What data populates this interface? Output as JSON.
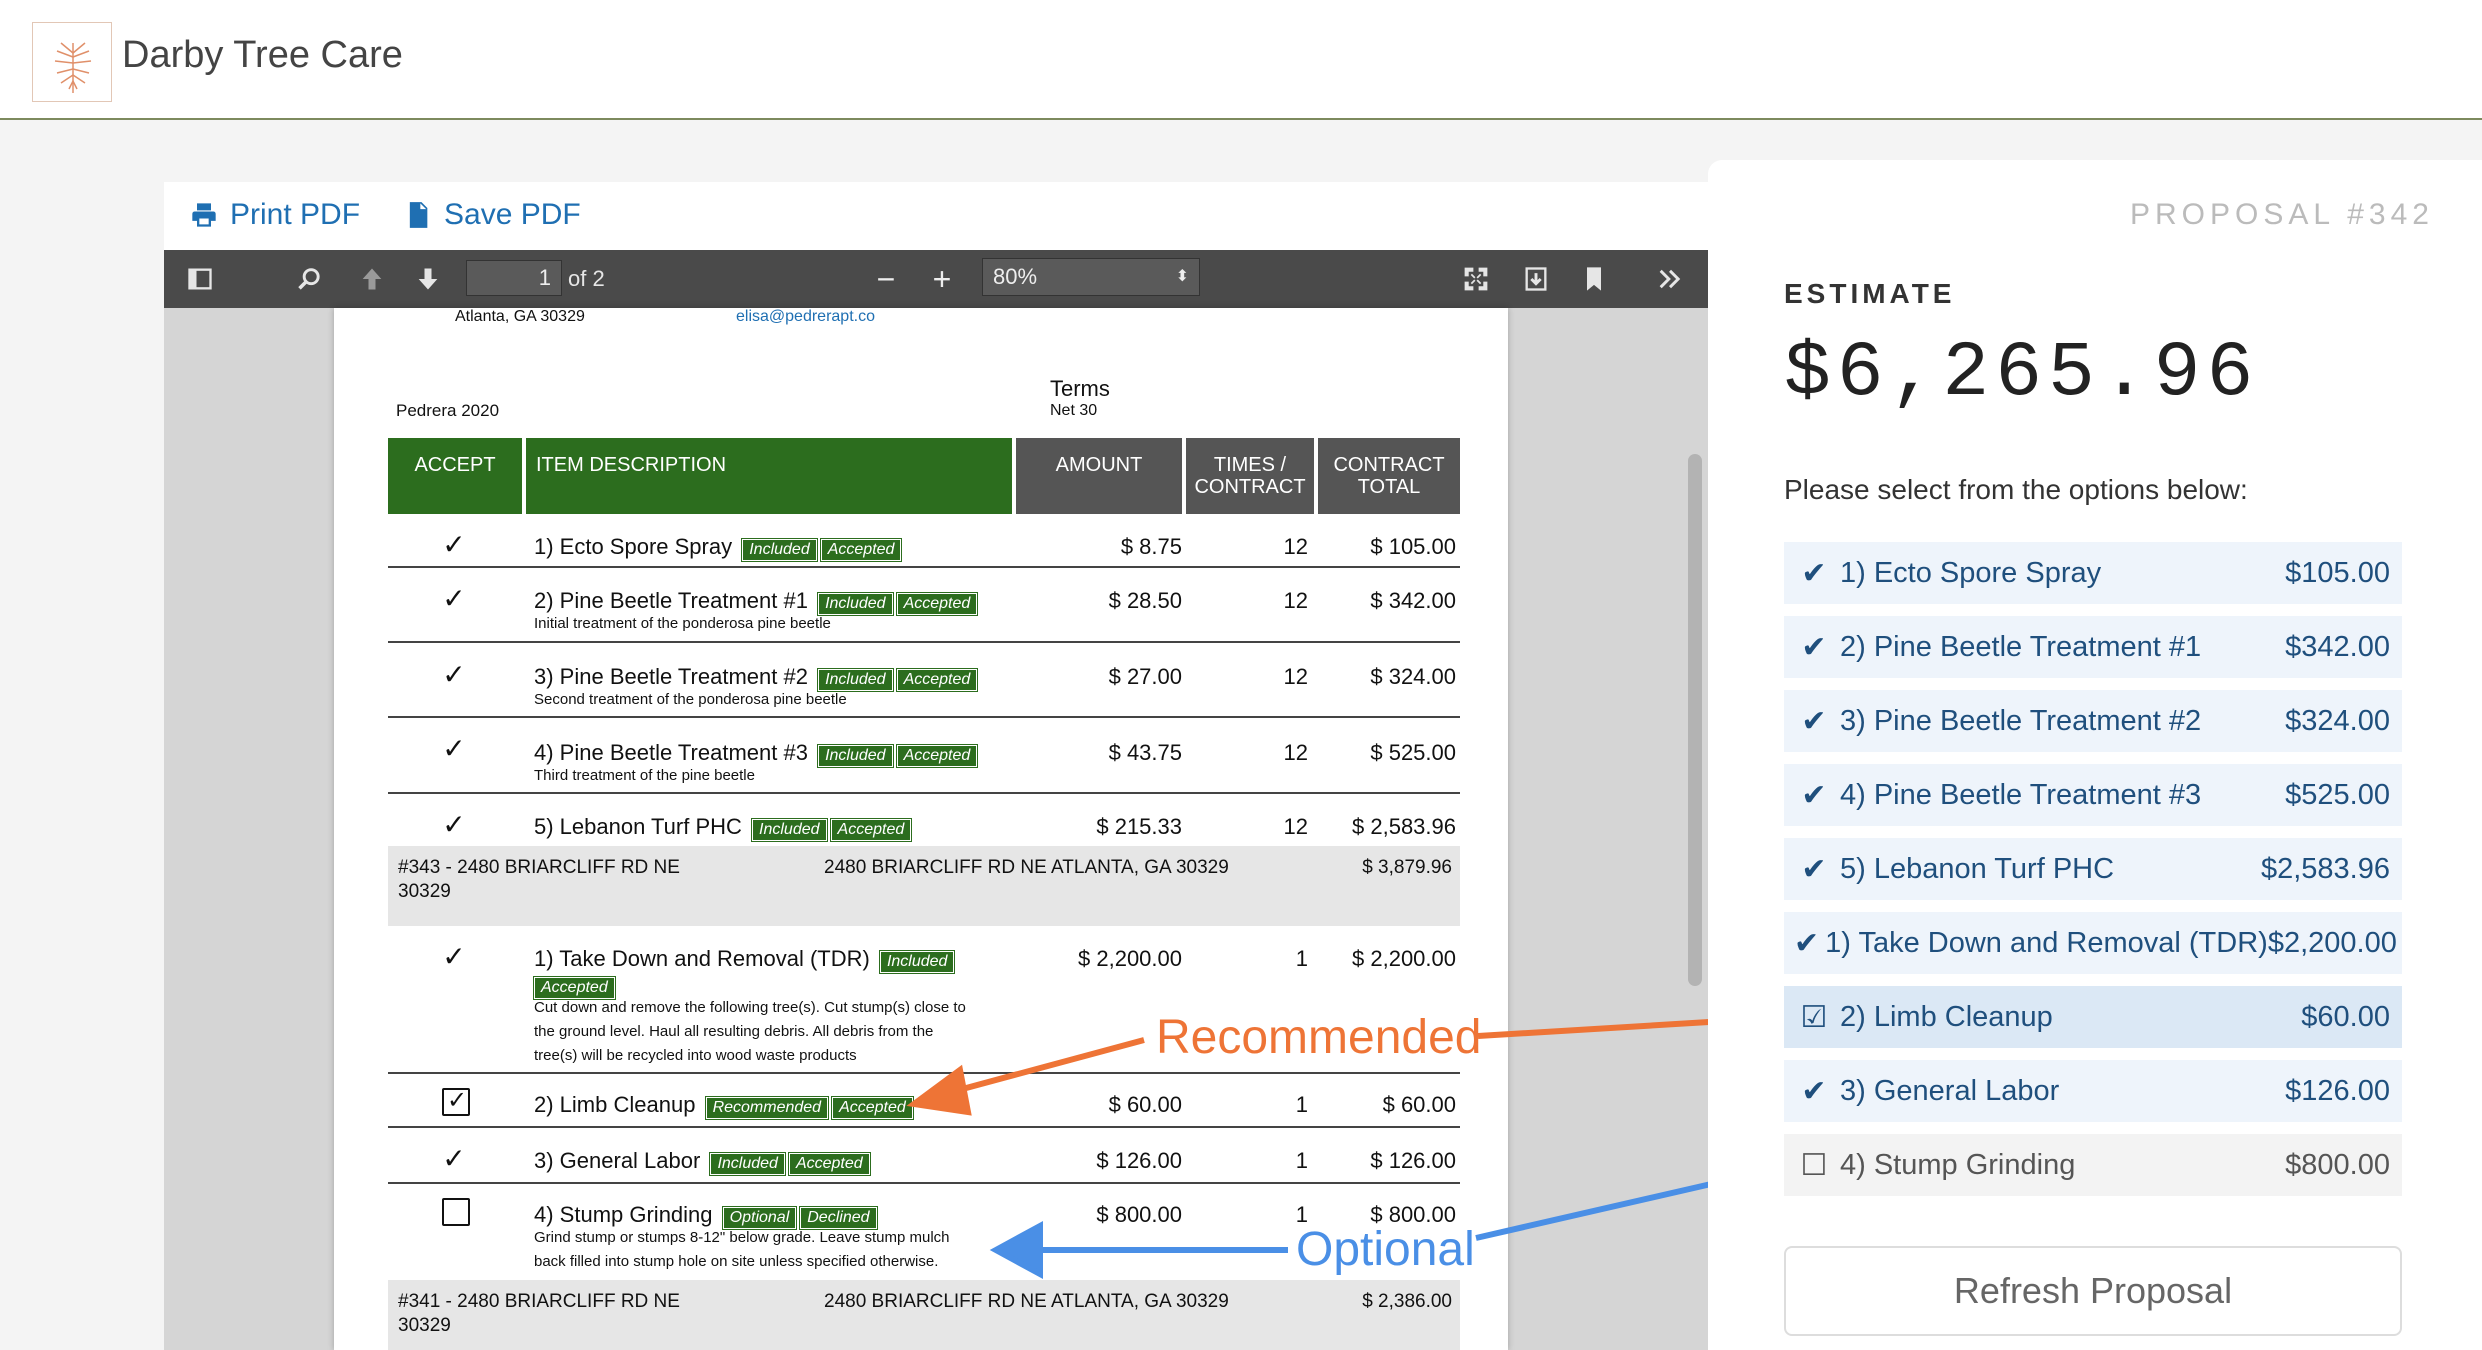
{
  "header": {
    "brand": "Darby Tree Care"
  },
  "pdf_actions": {
    "print": "Print PDF",
    "save": "Save PDF"
  },
  "toolbar": {
    "page_value": "1",
    "page_of": "of 2",
    "zoom": "80%"
  },
  "page": {
    "address": "Atlanta, GA 30329",
    "email": "elisa@pedrerapt.co",
    "customer": "Pedrera 2020",
    "terms_label": "Terms",
    "terms_value": "Net 30",
    "headers": {
      "accept": "ACCEPT",
      "description": "ITEM DESCRIPTION",
      "amount": "AMOUNT",
      "times_1": "TIMES /",
      "times_2": "CONTRACT",
      "total_1": "CONTRACT",
      "total_2": "TOTAL"
    },
    "items": [
      {
        "name": "1) Ecto Spore Spray",
        "b1": "Included",
        "b2": "Accepted",
        "note": "",
        "amount": "$ 8.75",
        "times": "12",
        "total": "$ 105.00"
      },
      {
        "name": "2) Pine Beetle Treatment #1",
        "b1": "Included",
        "b2": "Accepted",
        "note": "Initial treatment of the ponderosa pine beetle",
        "amount": "$ 28.50",
        "times": "12",
        "total": "$ 342.00"
      },
      {
        "name": "3) Pine Beetle Treatment #2",
        "b1": "Included",
        "b2": "Accepted",
        "note": "Second treatment of the ponderosa pine beetle",
        "amount": "$ 27.00",
        "times": "12",
        "total": "$ 324.00"
      },
      {
        "name": "4) Pine Beetle Treatment #3",
        "b1": "Included",
        "b2": "Accepted",
        "note": "Third treatment of the pine beetle",
        "amount": "$ 43.75",
        "times": "12",
        "total": "$ 525.00"
      },
      {
        "name": "5) Lebanon Turf PHC",
        "b1": "Included",
        "b2": "Accepted",
        "note": "",
        "amount": "$ 215.33",
        "times": "12",
        "total": "$ 2,583.96"
      },
      {
        "name": "1) Take Down and Removal (TDR)",
        "b1": "Included",
        "b2": "Accepted",
        "note1": "Cut down and remove the following tree(s). Cut stump(s) close to",
        "note2": "the ground level. Haul all resulting debris. All debris from the",
        "note3": "tree(s) will be recycled into wood waste products",
        "amount": "$ 2,200.00",
        "times": "1",
        "total": "$ 2,200.00"
      },
      {
        "name": "2) Limb Cleanup",
        "b1": "Recommended",
        "b2": "Accepted",
        "amount": "$ 60.00",
        "times": "1",
        "total": "$ 60.00"
      },
      {
        "name": "3) General Labor",
        "b1": "Included",
        "b2": "Accepted",
        "amount": "$ 126.00",
        "times": "1",
        "total": "$ 126.00"
      },
      {
        "name": "4) Stump Grinding",
        "b1": "Optional",
        "b2": "Declined",
        "note1": "Grind stump or stumps 8-12\" below grade. Leave stump mulch",
        "note2": "back filled into stump hole on site unless specified otherwise.",
        "amount": "$ 800.00",
        "times": "1",
        "total": "$ 800.00"
      }
    ],
    "groups": [
      {
        "id1": "#343 - 2480 BRIARCLIFF RD NE",
        "id2": "30329",
        "address": "2480 BRIARCLIFF RD NE ATLANTA, GA 30329",
        "total": "$ 3,879.96"
      },
      {
        "id1": "#341 - 2480 BRIARCLIFF RD NE",
        "id2": "30329",
        "address": "2480 BRIARCLIFF RD NE ATLANTA, GA 30329",
        "total": "$ 2,386.00"
      }
    ]
  },
  "annotations": {
    "recommended": "Recommended",
    "optional": "Optional"
  },
  "panel": {
    "proposal": "PROPOSAL #342",
    "estimate_label": "ESTIMATE",
    "estimate_value": "$6,265.96",
    "instructions": "Please select from the options below:",
    "options": [
      {
        "label": "1) Ecto Spore Spray",
        "value": "$105.00"
      },
      {
        "label": "2) Pine Beetle Treatment #1",
        "value": "$342.00"
      },
      {
        "label": "3) Pine Beetle Treatment #2",
        "value": "$324.00"
      },
      {
        "label": "4) Pine Beetle Treatment #3",
        "value": "$525.00"
      },
      {
        "label": "5) Lebanon Turf PHC",
        "value": "$2,583.96"
      },
      {
        "label": "1) Take Down and Removal (TDR)",
        "value": "$2,200.00"
      },
      {
        "label": "2) Limb Cleanup",
        "value": "$60.00"
      },
      {
        "label": "3) General Labor",
        "value": "$126.00"
      },
      {
        "label": "4) Stump Grinding",
        "value": "$800.00"
      }
    ],
    "refresh": "Refresh Proposal"
  },
  "colors": {
    "accent_green": "#2c6d1e",
    "link_blue": "#1f6fb2",
    "annotation_orange": "#ee7436",
    "annotation_blue": "#4a8fe6"
  }
}
